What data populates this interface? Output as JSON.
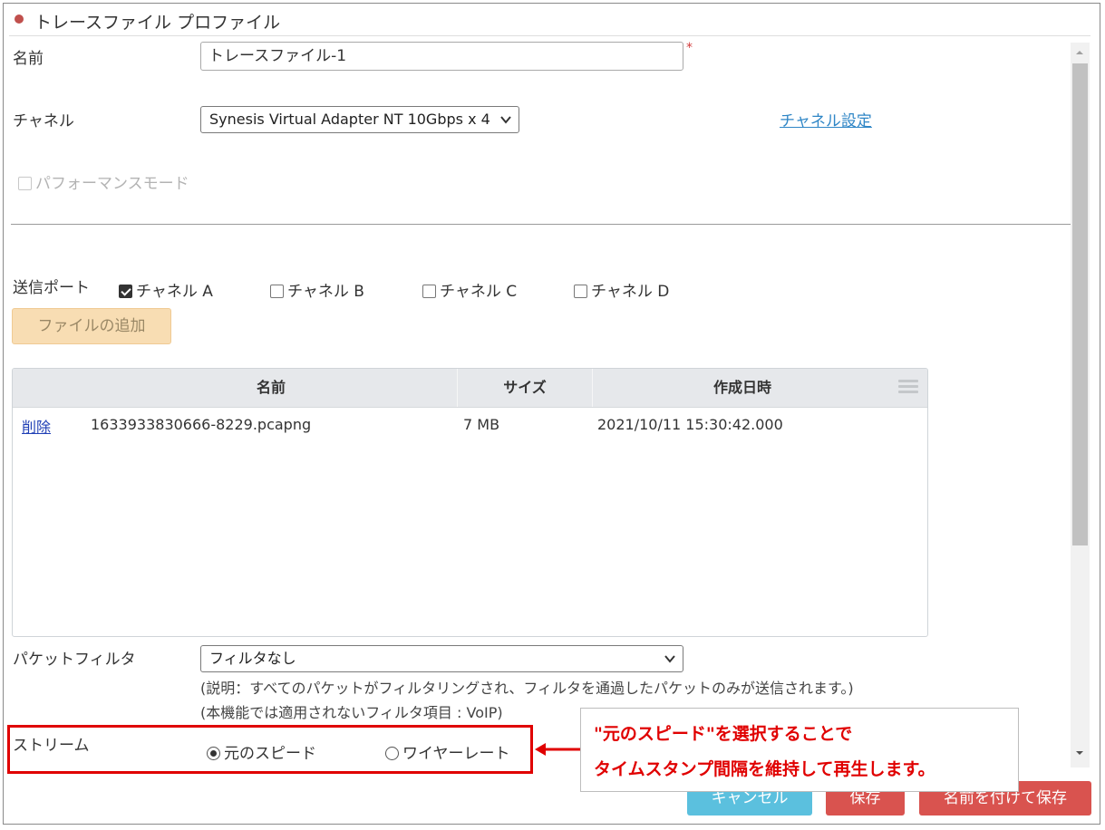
{
  "dialog": {
    "title": "トレースファイル プロファイル"
  },
  "form": {
    "name_label": "名前",
    "name_value": "トレースファイル-1",
    "required_mark": "*",
    "channel_label": "チャネル",
    "channel_value": "Synesis Virtual Adapter NT 10Gbps x 4",
    "channel_settings_link": "チャネル設定",
    "performance_mode_label": "パフォーマンスモード",
    "send_port_label": "送信ポート",
    "ports": [
      {
        "label": "チャネル A",
        "checked": true
      },
      {
        "label": "チャネル B",
        "checked": false
      },
      {
        "label": "チャネル C",
        "checked": false
      },
      {
        "label": "チャネル D",
        "checked": false
      }
    ],
    "add_file_button": "ファイルの追加"
  },
  "file_table": {
    "columns": [
      "名前",
      "サイズ",
      "作成日時"
    ],
    "rows": [
      {
        "action": "削除",
        "name": "1633933830666-8229.pcapng",
        "size": "7 MB",
        "created": "2021/10/11 15:30:42.000"
      }
    ]
  },
  "filter": {
    "label": "パケットフィルタ",
    "value": "フィルタなし",
    "note1": "(説明：すべてのパケットがフィルタリングされ、フィルタを通過したパケットのみが送信されます。)",
    "note2": "(本機能では適用されないフィルタ項目 : VoIP)"
  },
  "stream": {
    "label": "ストリーム",
    "options": [
      {
        "label": "元のスピード",
        "selected": true
      },
      {
        "label": "ワイヤーレート",
        "selected": false
      }
    ]
  },
  "annotation": {
    "line1": "\"元のスピード\"を選択することで",
    "line2": "タイムスタンプ間隔を維持して再生します。",
    "color": "#e00000"
  },
  "footer": {
    "cancel": "キャンセル",
    "save": "保存",
    "save_as": "名前を付けて保存"
  },
  "colors": {
    "accent_red": "#d9534f",
    "cancel_blue": "#5bc0de",
    "link_blue": "#2f86c6",
    "add_button_bg": "#f8ddb3"
  }
}
